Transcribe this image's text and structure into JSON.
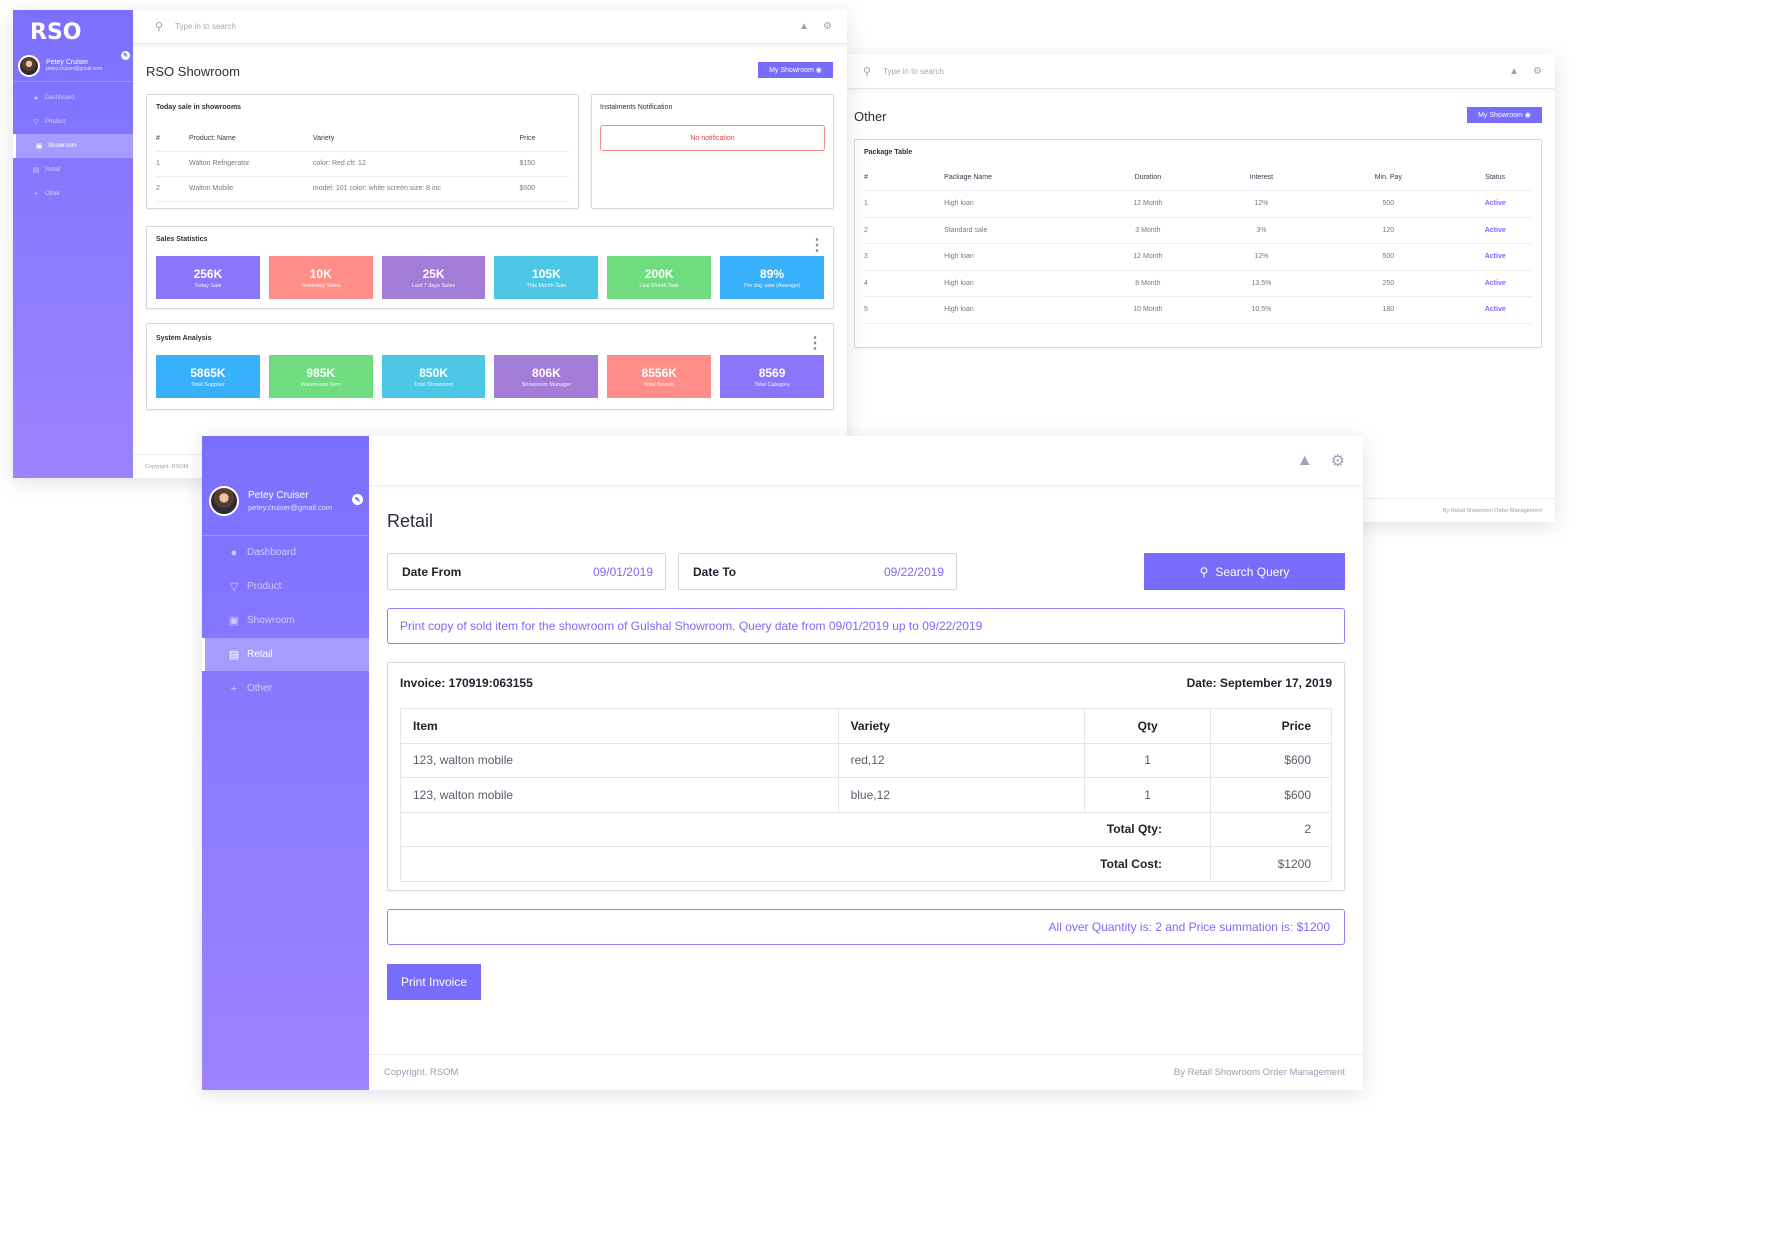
{
  "brand": {
    "logo": "RSO",
    "accent": "#776cfb"
  },
  "user": {
    "name": "Petey Cruiser",
    "email": "petey.cruiser@gmail.com"
  },
  "nav": [
    {
      "label": "Dashboard",
      "icon": "dashboard-icon"
    },
    {
      "label": "Product",
      "icon": "basket-icon"
    },
    {
      "label": "Showroom",
      "icon": "showroom-icon"
    },
    {
      "label": "Retail",
      "icon": "retail-icon"
    },
    {
      "label": "Other",
      "icon": "plus-icon"
    }
  ],
  "search": {
    "placeholder": "Type in to search"
  },
  "icons": {
    "search": "⚲",
    "bell": "🔔",
    "gear": "⚙",
    "edit": "✎",
    "basket": "🧺",
    "kebab": "⋮"
  },
  "footer": {
    "copyright": "Copyright. RSOM",
    "credit": "By Retail Showroom Order Management"
  },
  "showroom": {
    "title": "RSO Showroom",
    "my_showroom_button": "My Showroom",
    "today_sale": {
      "title": "Today sale in showrooms",
      "columns": [
        "#",
        "Product: Name",
        "Variety",
        "Price"
      ],
      "rows": [
        [
          "1",
          "Walton Refrigerator",
          "color: Red cft: 12",
          "$150"
        ],
        [
          "2",
          "Walton Mobile",
          "model: 101 color: white screen size: 8 inc",
          "$500"
        ]
      ]
    },
    "instalments": {
      "title": "Instalments Notification",
      "message": "No notification"
    },
    "sales_statistics": {
      "title": "Sales Statistics",
      "tiles": [
        {
          "value": "256K",
          "label": "Today Sale",
          "color": "#8a75fb"
        },
        {
          "value": "10K",
          "label": "Yesterday Sales",
          "color": "#fe8e87"
        },
        {
          "value": "25K",
          "label": "Last 7 days Sales",
          "color": "#a27cd6"
        },
        {
          "value": "105K",
          "label": "This Month Sale",
          "color": "#4cc8e6"
        },
        {
          "value": "200K",
          "label": "Last Month Sale",
          "color": "#6fdc80"
        },
        {
          "value": "89%",
          "label": "Per day sale (Average)",
          "color": "#39b0fa"
        }
      ]
    },
    "system_analysis": {
      "title": "System Analysis",
      "tiles": [
        {
          "value": "5865K",
          "label": "Total Supplier",
          "color": "#39b0fa"
        },
        {
          "value": "985K",
          "label": "Warehouse Item",
          "color": "#6fdc80"
        },
        {
          "value": "850K",
          "label": "Total Showroom",
          "color": "#4cc8e6"
        },
        {
          "value": "806K",
          "label": "Showroom Manager",
          "color": "#a27cd6"
        },
        {
          "value": "8556K",
          "label": "Total Brands",
          "color": "#fe8e87"
        },
        {
          "value": "8569",
          "label": "Total Category",
          "color": "#8a75fb"
        }
      ]
    }
  },
  "other": {
    "title": "Other",
    "my_showroom_button": "My Showroom",
    "package_table": {
      "title": "Package Table",
      "columns": [
        "#",
        "Package Name",
        "Duration",
        "Interest",
        "Min. Pay",
        "Status"
      ],
      "rows": [
        [
          "1",
          "High loan",
          "12 Month",
          "12%",
          "500",
          "Active"
        ],
        [
          "2",
          "Standard sale",
          "3 Month",
          "3%",
          "120",
          "Active"
        ],
        [
          "3",
          "High loan",
          "12 Month",
          "12%",
          "500",
          "Active"
        ],
        [
          "4",
          "High loan",
          "8 Month",
          "13.5%",
          "250",
          "Active"
        ],
        [
          "5",
          "High loan",
          "10 Month",
          "10.5%",
          "180",
          "Active"
        ]
      ]
    }
  },
  "retail": {
    "title": "Retail",
    "date_from": {
      "label": "Date From",
      "value": "09/01/2019"
    },
    "date_to": {
      "label": "Date To",
      "value": "09/22/2019"
    },
    "search_button": "Search Query",
    "print_info": "Print copy of sold item for the showroom of Gulshal Showroom. Query date from 09/01/2019 up to 09/22/2019",
    "invoice": {
      "number": "Invoice: 170919:063155",
      "date": "Date: September 17, 2019",
      "columns": [
        "Item",
        "Variety",
        "Qty",
        "Price"
      ],
      "rows": [
        [
          "123, walton mobile",
          "red,12",
          "1",
          "$600"
        ],
        [
          "123, walton mobile",
          "blue,12",
          "1",
          "$600"
        ]
      ],
      "total_qty_label": "Total Qty:",
      "total_qty": "2",
      "total_cost_label": "Total Cost:",
      "total_cost": "$1200"
    },
    "summary": "All over Quantity is: 2 and Price summation is: $1200",
    "print_button": "Print Invoice"
  }
}
